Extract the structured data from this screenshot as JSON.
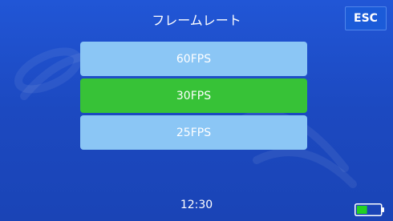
{
  "header": {
    "title": "フレームレート"
  },
  "esc_button": {
    "label": "ESC"
  },
  "options": [
    {
      "label": "60FPS",
      "selected": false
    },
    {
      "label": "30FPS",
      "selected": true
    },
    {
      "label": "25FPS",
      "selected": false
    }
  ],
  "status": {
    "clock": "12:30",
    "battery_icon": "battery-icon",
    "battery_level": 0.45
  },
  "colors": {
    "background": "#1e4fc8",
    "option_default": "#8bc6f5",
    "option_selected": "#37c237",
    "battery_fill": "#22d122"
  }
}
